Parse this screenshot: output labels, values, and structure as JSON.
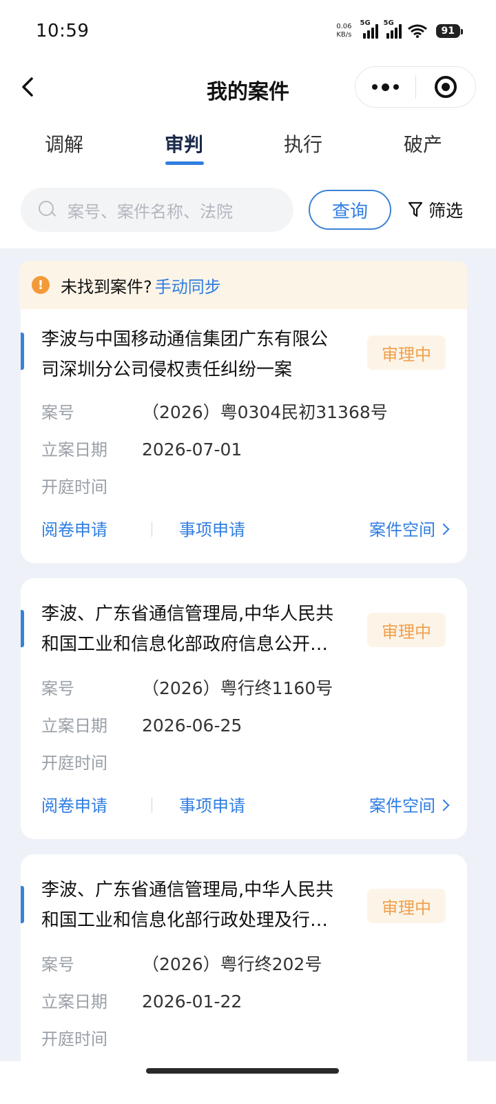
{
  "status_bar": {
    "time": "10:59",
    "net_speed_value": "0.06",
    "net_speed_unit": "KB/s",
    "sim1_label": "5G",
    "sim2_label": "5G",
    "battery": "91",
    "icons": [
      "signal-icon",
      "signal-icon",
      "wifi-icon",
      "battery-icon"
    ]
  },
  "header": {
    "title": "我的案件",
    "back_icon": "chevron-left-icon",
    "more_icon": "more-dots-icon",
    "close_icon": "target-close-icon"
  },
  "tabs": [
    {
      "label": "调解",
      "active": false
    },
    {
      "label": "审判",
      "active": true
    },
    {
      "label": "执行",
      "active": false
    },
    {
      "label": "破产",
      "active": false
    }
  ],
  "search": {
    "placeholder": "案号、案件名称、法院",
    "query_button": "查询",
    "filter_label": "筛选"
  },
  "notice": {
    "text": "未找到案件?",
    "link": "手动同步"
  },
  "labels": {
    "case_no": "案号",
    "filing_date": "立案日期",
    "hearing_time": "开庭时间",
    "action_read": "阅卷申请",
    "action_matter": "事项申请",
    "action_space": "案件空间"
  },
  "cases": [
    {
      "title": "李波与中国移动通信集团广东有限公司深圳分公司侵权责任纠纷一案",
      "title_line1": "李波与中国移动通信集团广东有限公",
      "title_line2": "司深圳分公司侵权责任纠纷一案",
      "status": "审理中",
      "case_no": "（2026）粤0304民初31368号",
      "filing_date": "2026-07-01",
      "hearing_time": ""
    },
    {
      "title_line1": "李波、广东省通信管理局,中华人民共",
      "title_line2": "和国工业和信息化部政府信息公开…",
      "status": "审理中",
      "case_no": "（2026）粤行终1160号",
      "filing_date": "2026-06-25",
      "hearing_time": ""
    },
    {
      "title_line1": "李波、广东省通信管理局,中华人民共",
      "title_line2": "和国工业和信息化部行政处理及行…",
      "status": "审理中",
      "case_no": "（2026）粤行终202号",
      "filing_date": "2026-01-22",
      "hearing_time": ""
    }
  ],
  "colors": {
    "accent": "#2f7de1",
    "status_text": "#f0a04b",
    "status_bg": "#fdf4e8",
    "list_bg": "#eef2f8"
  }
}
